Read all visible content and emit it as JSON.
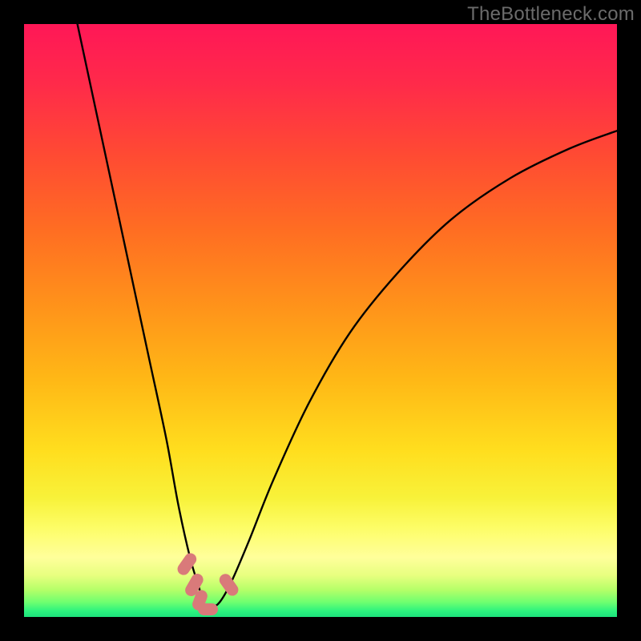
{
  "watermark": "TheBottleneck.com",
  "colors": {
    "black": "#000000",
    "marker": "#d97a7a",
    "curve": "#000000",
    "gradient_stops": [
      {
        "offset": 0.0,
        "color": "#ff1757"
      },
      {
        "offset": 0.1,
        "color": "#ff2a4a"
      },
      {
        "offset": 0.22,
        "color": "#ff4a33"
      },
      {
        "offset": 0.35,
        "color": "#ff6e22"
      },
      {
        "offset": 0.48,
        "color": "#ff941a"
      },
      {
        "offset": 0.6,
        "color": "#ffb816"
      },
      {
        "offset": 0.72,
        "color": "#ffde1e"
      },
      {
        "offset": 0.8,
        "color": "#f8f23a"
      },
      {
        "offset": 0.85,
        "color": "#fdfd67"
      },
      {
        "offset": 0.9,
        "color": "#ffff9b"
      },
      {
        "offset": 0.93,
        "color": "#e7ff7f"
      },
      {
        "offset": 0.955,
        "color": "#b3ff68"
      },
      {
        "offset": 0.975,
        "color": "#6fff70"
      },
      {
        "offset": 0.99,
        "color": "#2cf37e"
      },
      {
        "offset": 1.0,
        "color": "#1de27c"
      }
    ]
  },
  "chart_data": {
    "type": "line",
    "title": "",
    "xlabel": "",
    "ylabel": "",
    "xlim": [
      0,
      100
    ],
    "ylim": [
      0,
      100
    ],
    "series": [
      {
        "name": "curve",
        "x": [
          9,
          12,
          15,
          18,
          21,
          24,
          26,
          28,
          29.5,
          30.5,
          31.5,
          33,
          35,
          38,
          42,
          48,
          55,
          63,
          72,
          82,
          92,
          100
        ],
        "y": [
          100,
          86,
          72,
          58,
          44,
          30,
          19,
          10,
          5,
          1.5,
          1.5,
          2.5,
          6,
          13,
          23,
          36,
          48,
          58,
          67,
          74,
          79,
          82
        ]
      }
    ],
    "markers": [
      {
        "x": 27.5,
        "y": 9,
        "w": 2,
        "h": 4,
        "r": 35
      },
      {
        "x": 28.7,
        "y": 5.5,
        "w": 2,
        "h": 4,
        "r": 30
      },
      {
        "x": 29.7,
        "y": 2.8,
        "w": 2,
        "h": 3.5,
        "r": 20
      },
      {
        "x": 31.0,
        "y": 1.3,
        "w": 3.5,
        "h": 2,
        "r": 0
      },
      {
        "x": 34.5,
        "y": 5.5,
        "w": 2,
        "h": 4,
        "r": -35
      }
    ],
    "note": "x=0..100 maps left→right across plot area; y=0..100 maps bottom→top. Values are visually estimated; axes unlabeled in source."
  }
}
